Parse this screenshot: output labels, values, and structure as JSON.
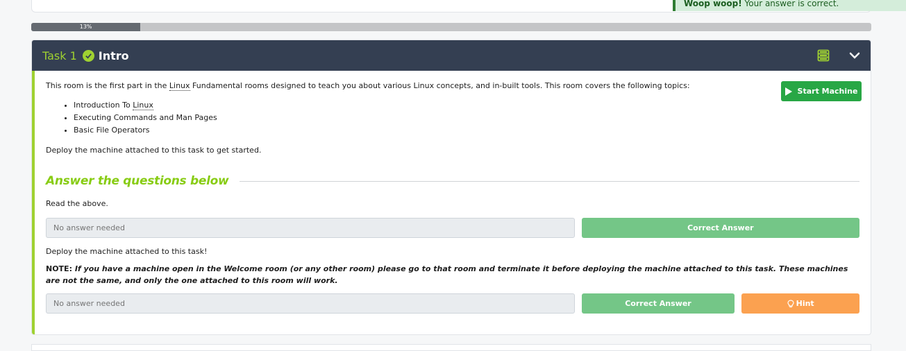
{
  "toast": {
    "bold": "Woop woop!",
    "message": " Your answer is correct."
  },
  "progress": {
    "value": 0.13,
    "label": "13%"
  },
  "task": {
    "label": "Task 1",
    "title": "Intro",
    "start_machine_label": "Start Machine",
    "intro": {
      "before": "This room is the first part in the ",
      "abbr": "Linux",
      "after": " Fundamental rooms designed to teach you about various Linux concepts, and in-built tools. This room covers the following topics:"
    },
    "topics": [
      {
        "before": "Introduction To ",
        "abbr": "Linux"
      },
      {
        "before": "Executing Commands and Man Pages",
        "abbr": ""
      },
      {
        "before": "Basic File Operators",
        "abbr": ""
      }
    ],
    "deploy_text": "Deploy the machine attached to this task to get started.",
    "answer_heading": "Answer the questions below",
    "questions": [
      {
        "text": "Read the above.",
        "placeholder": "No answer needed",
        "correct_label": "Correct Answer"
      },
      {
        "text": "Deploy the machine attached to this task!",
        "note_label": "NOTE:",
        "note": " If you have a machine open in the Welcome room (or any other room) please go to that room and terminate it before deploying the machine attached to this task. These machines are not the same, and only the one attached to this room will work.",
        "placeholder": "No answer needed",
        "correct_label": "Correct Answer",
        "hint_label": "Hint"
      }
    ]
  },
  "colors": {
    "header_bg": "#343f52",
    "accent_green": "#9fd131",
    "start_button": "#28a745",
    "correct_button": "#74c687",
    "hint_button": "#fba150"
  },
  "icons": [
    "check-circle-icon",
    "notes-icon",
    "chevron-down-icon",
    "play-icon",
    "lightbulb-icon"
  ]
}
